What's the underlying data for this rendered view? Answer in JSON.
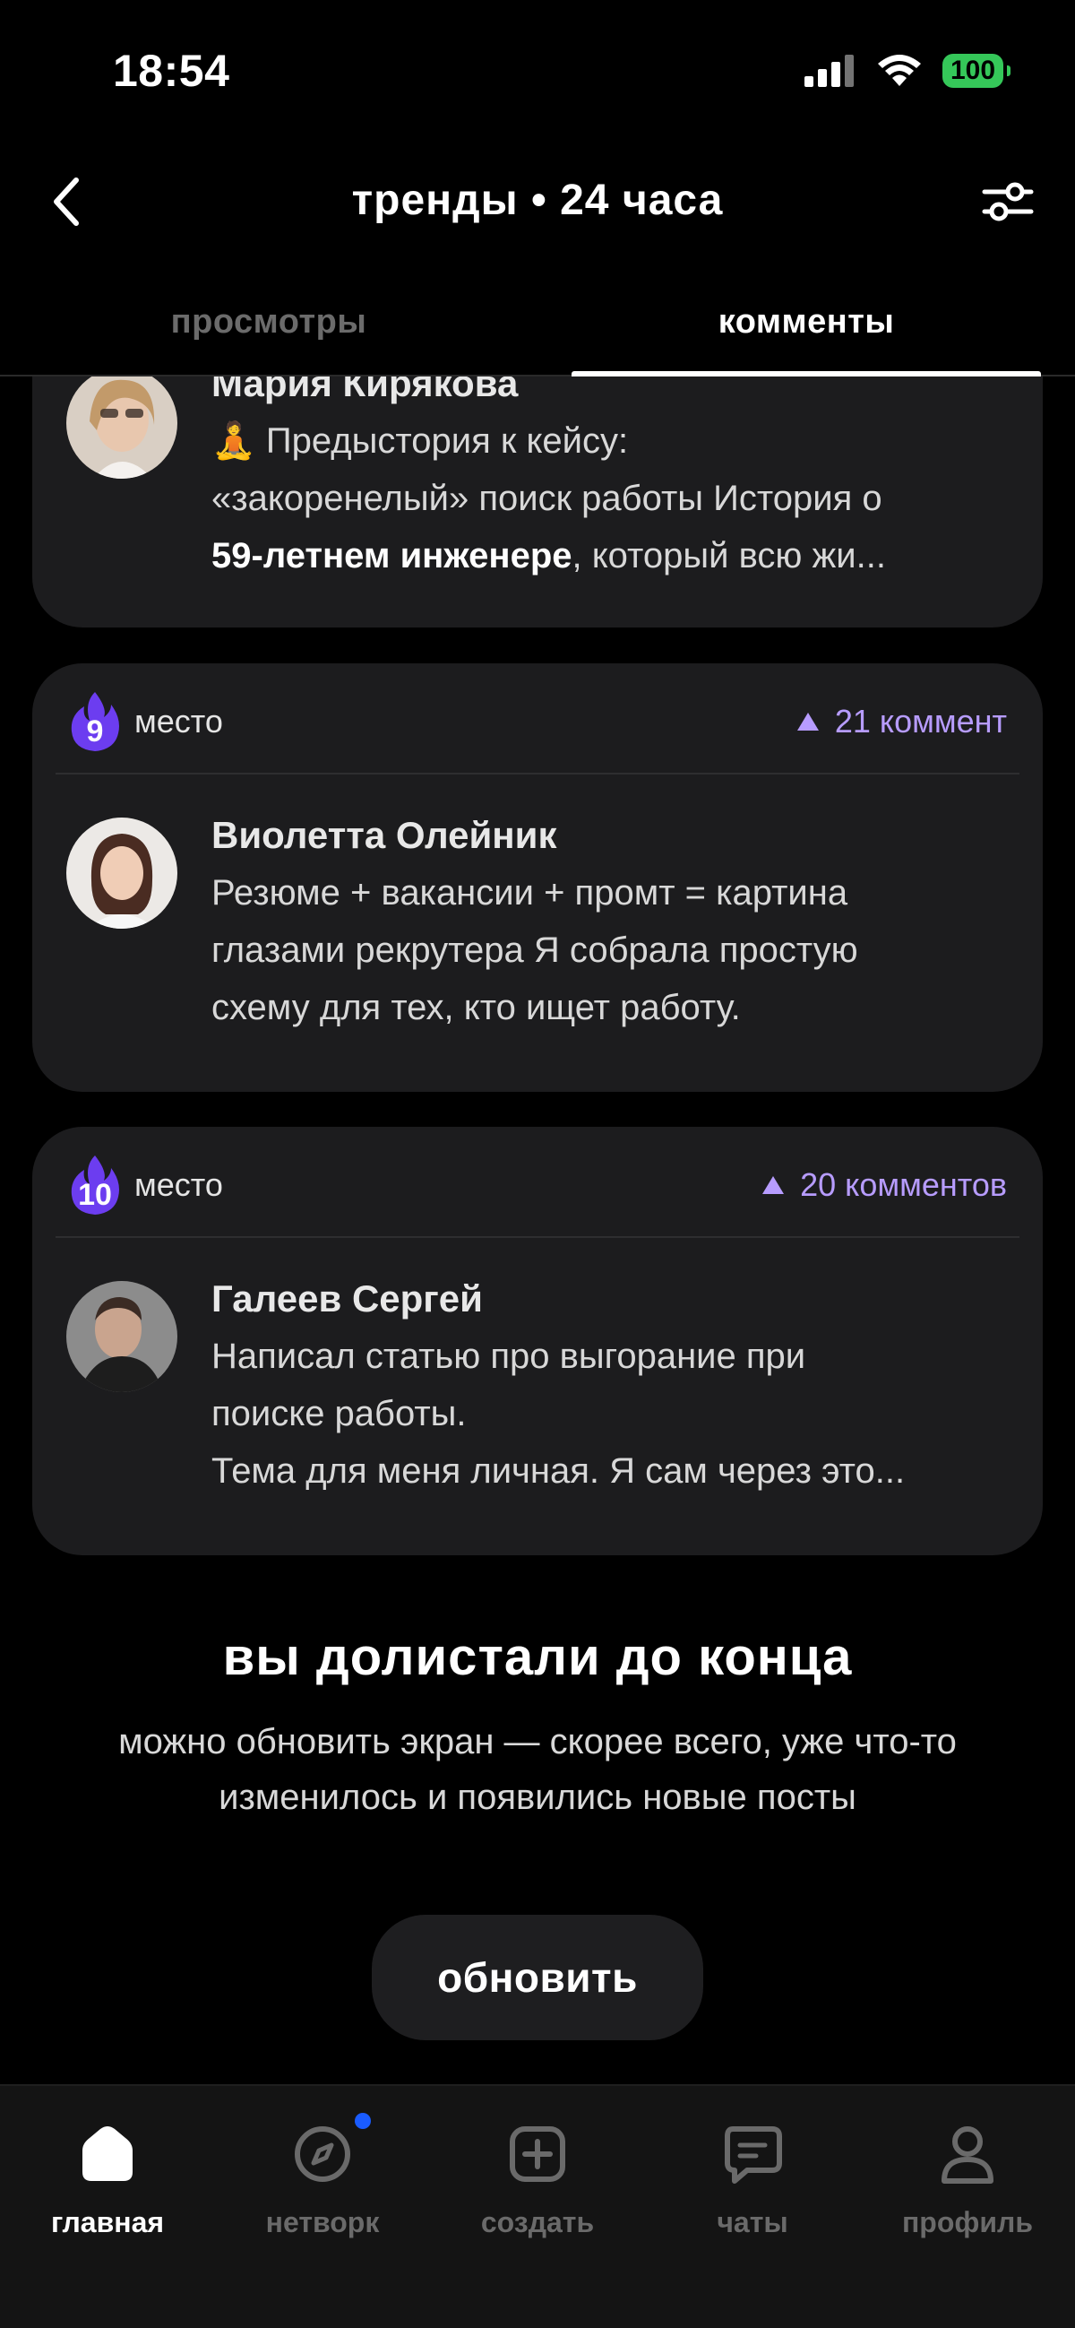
{
  "status_bar": {
    "time": "18:54",
    "battery": "100"
  },
  "header": {
    "title": "тренды • 24 часа",
    "back_icon": "chevron-left-icon",
    "filter_icon": "sliders-icon"
  },
  "tabs": [
    {
      "label": "просмотры",
      "active": false
    },
    {
      "label": "комменты",
      "active": true
    }
  ],
  "cards": [
    {
      "author": "Мария Кирякова",
      "text_lines": [
        "🧘 Предыстория к кейсу:",
        "«закоренелый» поиск работы История о",
        "59-летнем инженере, который всю жи..."
      ],
      "bold_fragment": "59-летнем инженере"
    },
    {
      "rank": "9",
      "rank_label": "место",
      "count": "21 коммент",
      "author": "Виолетта Олейник",
      "text_lines": [
        "Резюме + вакансии + промт = картина",
        "глазами рекрутера Я собрала простую",
        "схему для тех, кто ищет работу."
      ]
    },
    {
      "rank": "10",
      "rank_label": "место",
      "count": "20 комментов",
      "author": "Галеев Сергей",
      "text_lines": [
        "Написал статью про выгорание при",
        "поиске работы.",
        "Тема для меня личная. Я сам через это..."
      ]
    }
  ],
  "end_section": {
    "title": "вы долистали до конца",
    "text": "можно обновить экран — скорее всего, уже что-то изменилось и появились новые посты",
    "button": "обновить"
  },
  "bottom_nav": [
    {
      "label": "главная",
      "icon": "home-icon",
      "active": true
    },
    {
      "label": "нетворк",
      "icon": "compass-icon",
      "active": false,
      "badge": true
    },
    {
      "label": "создать",
      "icon": "plus-square-icon",
      "active": false
    },
    {
      "label": "чаты",
      "icon": "chat-icon",
      "active": false
    },
    {
      "label": "профиль",
      "icon": "user-icon",
      "active": false
    }
  ],
  "colors": {
    "accent": "#b79cff",
    "flame": "#6c3df0",
    "notification": "#1a5cff",
    "battery": "#35c759"
  }
}
